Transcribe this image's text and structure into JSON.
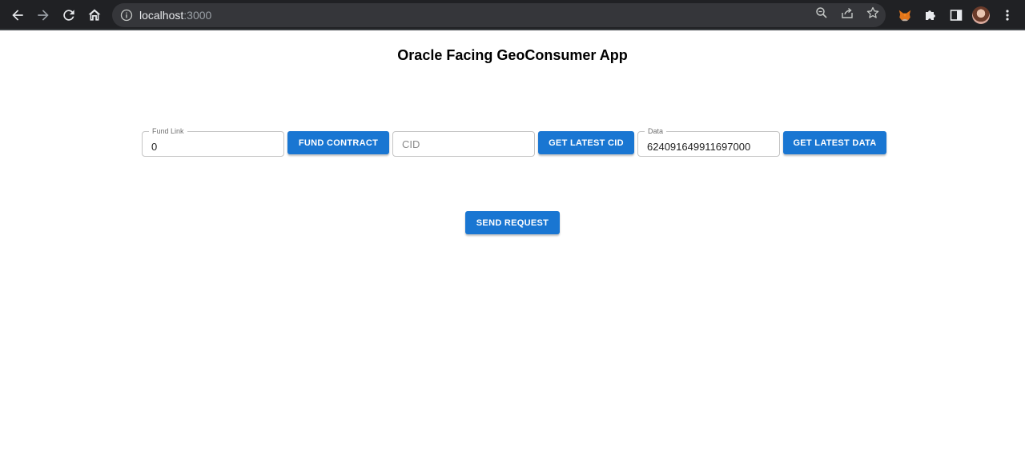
{
  "browser": {
    "url_host": "localhost",
    "url_port": ":3000"
  },
  "page": {
    "title": "Oracle Facing GeoConsumer App"
  },
  "fund": {
    "label": "Fund Link",
    "value": "0",
    "button": "FUND CONTRACT"
  },
  "cid": {
    "placeholder": "CID",
    "value": "",
    "button": "GET LATEST CID"
  },
  "data_field": {
    "label": "Data",
    "value": "624091649911697000",
    "button": "GET LATEST DATA"
  },
  "send": {
    "button": "SEND REQUEST"
  },
  "colors": {
    "primary": "#1976d2",
    "chrome_bg": "#202124",
    "omnibox_bg": "#35363a"
  },
  "icons": [
    "back-arrow-icon",
    "forward-arrow-icon",
    "reload-icon",
    "home-icon",
    "info-icon",
    "zoom-icon",
    "share-icon",
    "star-icon",
    "metamask-fox-icon",
    "puzzle-extensions-icon",
    "side-panel-icon",
    "kebab-menu-icon"
  ]
}
